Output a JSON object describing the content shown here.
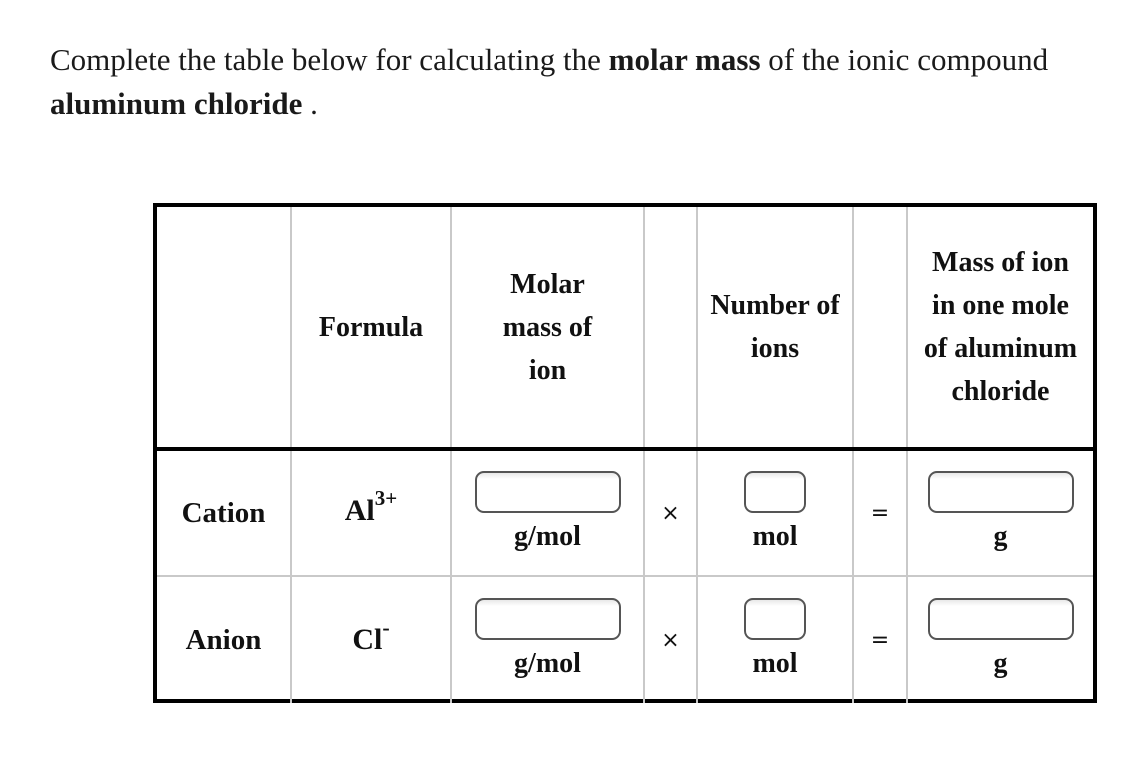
{
  "prompt": {
    "part1": "Complete the table below for calculating the ",
    "bold1": "molar mass",
    "part2": " of the ionic compound ",
    "bold2": "aluminum chloride",
    "part3": " ."
  },
  "table": {
    "headers": {
      "label": "",
      "formula": "Formula",
      "molar_mass": "Molar mass of ion",
      "op1": "",
      "number_of_ions": "Number of ions",
      "op2": "",
      "mass_in_mole": "Mass of ion in one mole of aluminum chloride"
    },
    "rows": [
      {
        "label": "Cation",
        "formula_base": "Al",
        "formula_charge": "3+",
        "molar_mass_value": "",
        "molar_mass_unit": "g/mol",
        "multiply_symbol": "×",
        "number_value": "",
        "number_unit": "mol",
        "equals_symbol": "=",
        "mass_value": "",
        "mass_unit": "g"
      },
      {
        "label": "Anion",
        "formula_base": "Cl",
        "formula_charge": "-",
        "molar_mass_value": "",
        "molar_mass_unit": "g/mol",
        "multiply_symbol": "×",
        "number_value": "",
        "number_unit": "mol",
        "equals_symbol": "=",
        "mass_value": "",
        "mass_unit": "g"
      }
    ]
  }
}
